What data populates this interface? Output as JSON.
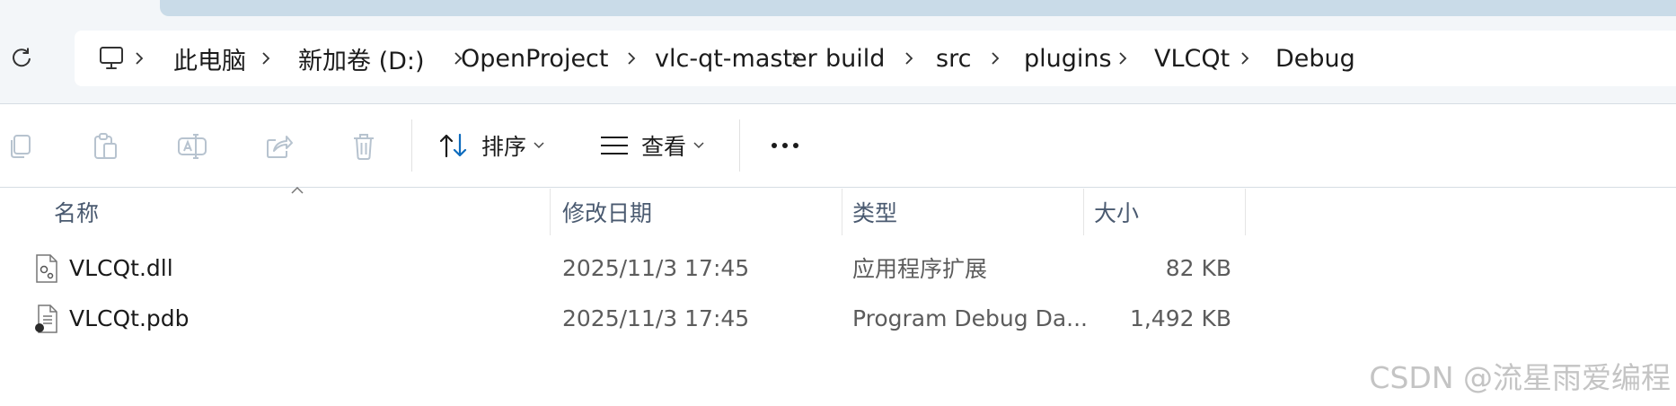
{
  "breadcrumb": {
    "segments": [
      "此电脑",
      "新加卷 (D:)",
      "OpenProject",
      "vlc-qt-master",
      "build",
      "src",
      "plugins",
      "VLCQt",
      "Debug"
    ]
  },
  "toolbar": {
    "sort_label": "排序",
    "view_label": "查看"
  },
  "columns": {
    "name": "名称",
    "modified": "修改日期",
    "type": "类型",
    "size": "大小"
  },
  "files": [
    {
      "name": "VLCQt.dll",
      "modified": "2025/11/3 17:45",
      "type": "应用程序扩展",
      "size": "82 KB",
      "icon": "dll-file-icon"
    },
    {
      "name": "VLCQt.pdb",
      "modified": "2025/11/3 17:45",
      "type": "Program Debug Da...",
      "size": "1,492 KB",
      "icon": "pdb-file-icon"
    }
  ],
  "watermark": "CSDN @流星雨爱编程",
  "colors": {
    "accent": "#0f6cbd",
    "address_bg": "#f3f6f9",
    "header_text": "#4a5a70"
  }
}
